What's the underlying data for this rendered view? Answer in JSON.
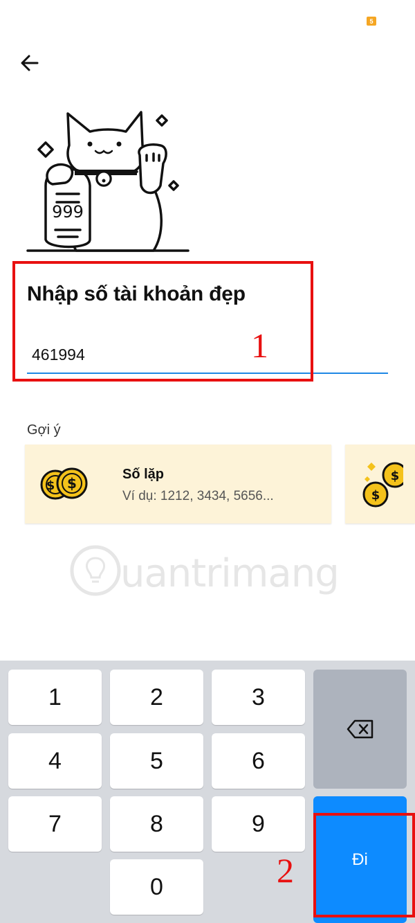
{
  "status_bar": {
    "badge": "5"
  },
  "header": {
    "back_icon": "arrow-left-icon"
  },
  "illustration": {
    "number_on_coin": "999",
    "icon": "lucky-cat-icon"
  },
  "form": {
    "title": "Nhập số tài khoản đẹp",
    "account_value": "461994"
  },
  "suggestions": {
    "label": "Gợi ý",
    "cards": [
      {
        "title": "Số lặp",
        "example": "Ví dụ: 1212, 3434, 5656...",
        "icon": "coins-icon"
      },
      {
        "icon": "coins-sparkle-icon"
      }
    ]
  },
  "watermark": {
    "text": "uantrimang"
  },
  "annotations": {
    "step1": "1",
    "step2": "2"
  },
  "keypad": {
    "keys": [
      "1",
      "2",
      "3",
      "4",
      "5",
      "6",
      "7",
      "8",
      "9",
      "0"
    ],
    "delete_icon": "backspace-icon",
    "go_label": "Đi"
  },
  "colors": {
    "accent": "#0d8bff",
    "underline": "#1e88e5",
    "card_bg": "#fdf3d8",
    "annotation": "#e81010",
    "coin": "#f4c21b"
  }
}
